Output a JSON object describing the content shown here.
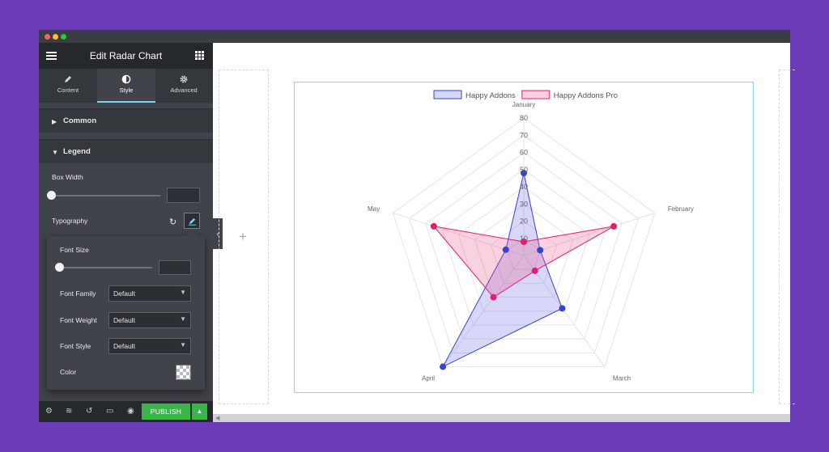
{
  "panel": {
    "title": "Edit Radar Chart",
    "tabs": [
      {
        "label": "Content",
        "icon": "pencil-icon"
      },
      {
        "label": "Style",
        "icon": "half-circle-icon"
      },
      {
        "label": "Advanced",
        "icon": "gear-icon"
      }
    ],
    "sections": {
      "common": "Common",
      "legend": "Legend"
    },
    "box_width_label": "Box Width",
    "typography_label": "Typography",
    "popover": {
      "font_size_label": "Font Size",
      "font_family_label": "Font Family",
      "font_family_value": "Default",
      "font_weight_label": "Font Weight",
      "font_weight_value": "Default",
      "font_style_label": "Font Style",
      "font_style_value": "Default",
      "color_label": "Color"
    },
    "publish_label": "PUBLISH"
  },
  "colors": {
    "accent": "#71d7f7",
    "publish": "#39b54a",
    "series1": "#3544c8",
    "series2": "#e0206e"
  },
  "chart_data": {
    "type": "radar",
    "categories": [
      "January",
      "February",
      "March",
      "April",
      "May"
    ],
    "ticks": [
      10,
      20,
      30,
      40,
      50,
      60,
      70,
      80
    ],
    "range": [
      0,
      80
    ],
    "grid": true,
    "legend_position": "top",
    "series": [
      {
        "name": "Happy Addons",
        "values": [
          48,
          10,
          38,
          80,
          11
        ]
      },
      {
        "name": "Happy Addons Pro",
        "values": [
          8,
          55,
          11,
          30,
          55
        ]
      }
    ]
  }
}
